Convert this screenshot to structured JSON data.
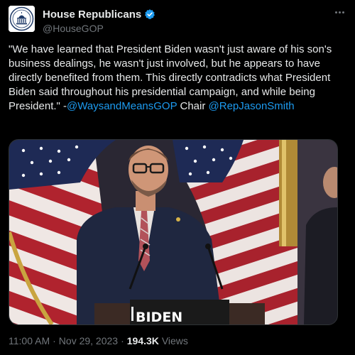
{
  "author": {
    "display_name": "House Republicans",
    "handle": "@HouseGOP",
    "verified_icon": "verified-badge-icon",
    "avatar_icon": "capitol-seal-icon"
  },
  "more_icon": "more-options-icon",
  "tweet": {
    "text_quote": "\"We have learned that President Biden wasn't just aware of his son's business dealings, he wasn't just involved, but he appears to have directly benefited from them. This directly contradicts what President Biden said throughout his presidential campaign, and while being President.\" -",
    "mention_1": "@WaysandMeansGOP",
    "text_mid": " Chair ",
    "mention_2": "@RepJasonSmith"
  },
  "media": {
    "description": "",
    "podium_sign": "BIDEN"
  },
  "meta": {
    "time": "11:00 AM",
    "date": "Nov 29, 2023",
    "separator": "·",
    "views_count": "194.3K",
    "views_label": "Views"
  },
  "colors": {
    "background": "#000000",
    "text": "#e7e9ea",
    "secondary_text": "#71767b",
    "link": "#1d9bf0",
    "verified_badge": "#1d9bf0"
  }
}
